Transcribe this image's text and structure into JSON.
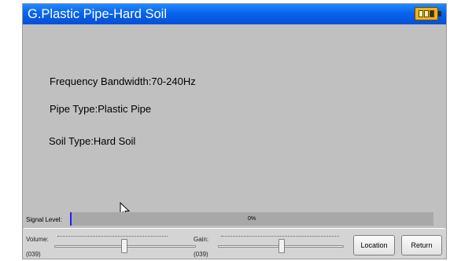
{
  "window": {
    "title": "G.Plastic Pipe-Hard Soil",
    "battery_icon": "battery-icon"
  },
  "info": {
    "frequency": "Frequency Bandwidth:70-240Hz",
    "pipe_type": "Pipe Type:Plastic Pipe",
    "soil_type": "Soil Type:Hard Soil"
  },
  "signal": {
    "label": "Signal Level:",
    "percent_text": "0%",
    "level_fraction": 0.0,
    "fill_color": "#2020ff"
  },
  "controls": {
    "volume_label": "Volume:",
    "volume_value": "(039)",
    "volume_fraction": 0.39,
    "gain_label": "Gain:",
    "gain_value": "(039)",
    "gain_fraction": 0.39,
    "location_label": "Location",
    "return_label": "Return"
  },
  "colors": {
    "titlebar": "#0a63ee",
    "background": "#c0c0c0"
  }
}
